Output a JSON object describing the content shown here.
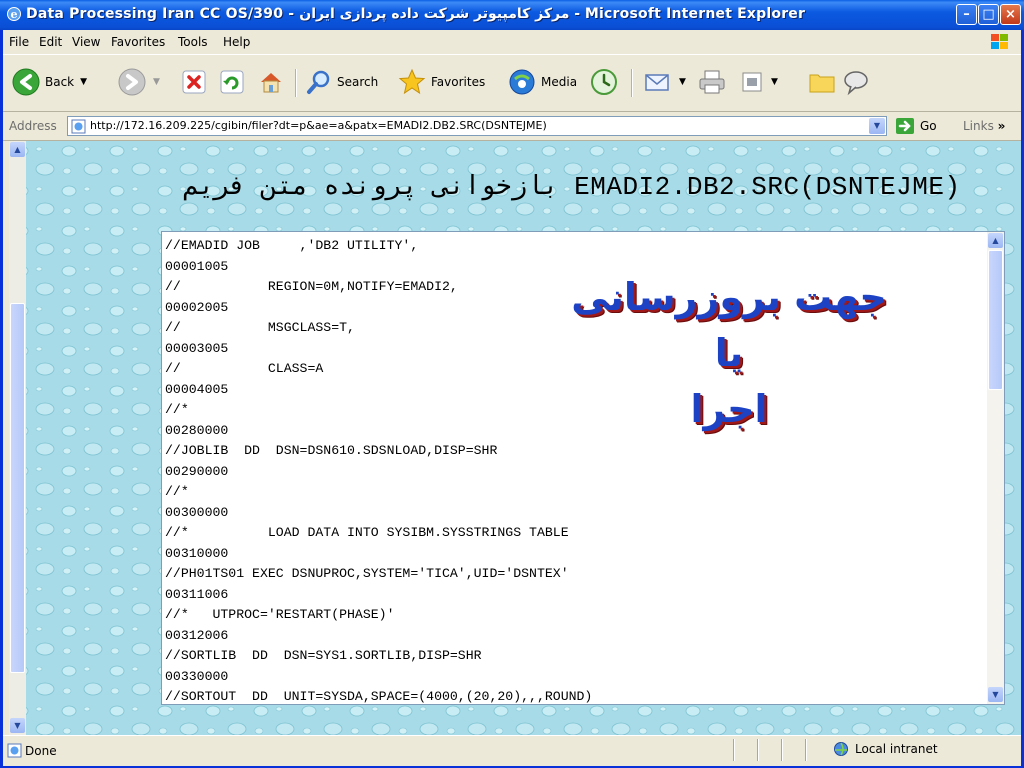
{
  "window": {
    "title": "Data Processing Iran CC OS/390 - مرکز کامپیوتر شرکت داده پردازی ایران - Microsoft Internet Explorer"
  },
  "menu": [
    "File",
    "Edit",
    "View",
    "Favorites",
    "Tools",
    "Help"
  ],
  "toolbar": {
    "back": "Back",
    "search": "Search",
    "favorites": "Favorites",
    "media": "Media"
  },
  "address": {
    "label": "Address",
    "url": "http://172.16.209.225/cgibin/filer?dt=p&ae=a&patx=EMADI2.DB2.SRC(DSNTEJME)",
    "go": "Go",
    "links": "Links"
  },
  "page": {
    "heading": "بازخوانی پرونده متن فریم EMADI2.DB2.SRC(DSNTEJME)",
    "overlay_line1": "جهت بروزرسانی یا",
    "overlay_line2": "اجرا",
    "code": "//EMADID JOB     ,'DB2 UTILITY',\n00001005\n//           REGION=0M,NOTIFY=EMADI2,\n00002005\n//           MSGCLASS=T,\n00003005\n//           CLASS=A\n00004005\n//*\n00280000\n//JOBLIB  DD  DSN=DSN610.SDSNLOAD,DISP=SHR\n00290000\n//*\n00300000\n//*          LOAD DATA INTO SYSIBM.SYSSTRINGS TABLE\n00310000\n//PH01TS01 EXEC DSNUPROC,SYSTEM='TICA',UID='DSNTEX'\n00311006\n//*   UTPROC='RESTART(PHASE)'\n00312006\n//SORTLIB  DD  DSN=SYS1.SORTLIB,DISP=SHR\n00330000\n//SORTOUT  DD  UNIT=SYSDA,SPACE=(4000,(20,20),,,ROUND)"
  },
  "status": {
    "text": "Done",
    "zone": "Local intranet"
  },
  "colors": {
    "titlebar": "#0a4fd6",
    "overlay_text": "#1d43c4",
    "overlay_shadow": "#a01818",
    "page_bg": "#a8dce8"
  }
}
